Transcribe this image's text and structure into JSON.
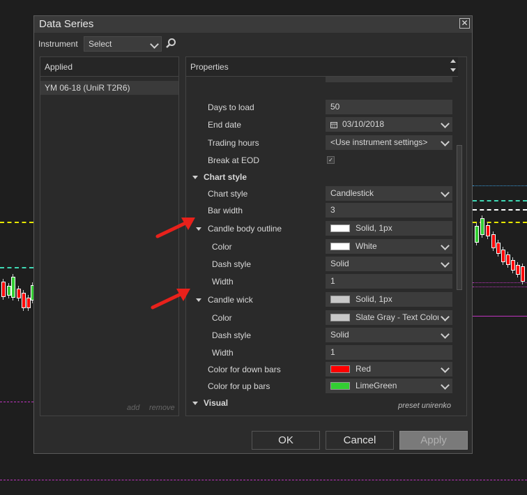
{
  "dialog": {
    "title": "Data Series",
    "close_glyph": "✕"
  },
  "instrument": {
    "label": "Instrument",
    "select_value": "Select"
  },
  "applied": {
    "header": "Applied",
    "items": [
      "YM 06-18 (UniR T2R6)"
    ],
    "add": "add",
    "remove": "remove"
  },
  "properties": {
    "header": "Properties",
    "preset": "preset unirenko",
    "rows": [
      {
        "label": "Days to load",
        "value": "50"
      },
      {
        "label": "End date",
        "value": "03/10/2018"
      },
      {
        "label": "Trading hours",
        "value": "<Use instrument settings>"
      },
      {
        "label": "Break at EOD",
        "value": "✓"
      },
      {
        "label": "Chart style",
        "section": true
      },
      {
        "label": "Chart style",
        "value": "Candlestick"
      },
      {
        "label": "Bar width",
        "value": "3"
      },
      {
        "label": "Candle body outline",
        "value": "Solid, 1px",
        "swatch": "#ffffff"
      },
      {
        "label": "Color",
        "value": "White",
        "swatch": "#ffffff"
      },
      {
        "label": "Dash style",
        "value": "Solid"
      },
      {
        "label": "Width",
        "value": "1"
      },
      {
        "label": "Candle wick",
        "value": "Solid, 1px",
        "swatch": "#c8c8c8"
      },
      {
        "label": "Color",
        "value": "Slate Gray - Text Color",
        "swatch": "#c8c8c8"
      },
      {
        "label": "Dash style",
        "value": "Solid"
      },
      {
        "label": "Width",
        "value": "1"
      },
      {
        "label": "Color for down bars",
        "value": "Red",
        "swatch": "#ff0000"
      },
      {
        "label": "Color for up bars",
        "value": "LimeGreen",
        "swatch": "#32cd32"
      },
      {
        "label": "Visual",
        "section": true
      }
    ]
  },
  "buttons": {
    "ok": "OK",
    "cancel": "Cancel",
    "apply": "Apply"
  },
  "colors": {
    "down": "#ff0000",
    "up": "#32cd32",
    "annotation_arrow": "#e8211b"
  }
}
